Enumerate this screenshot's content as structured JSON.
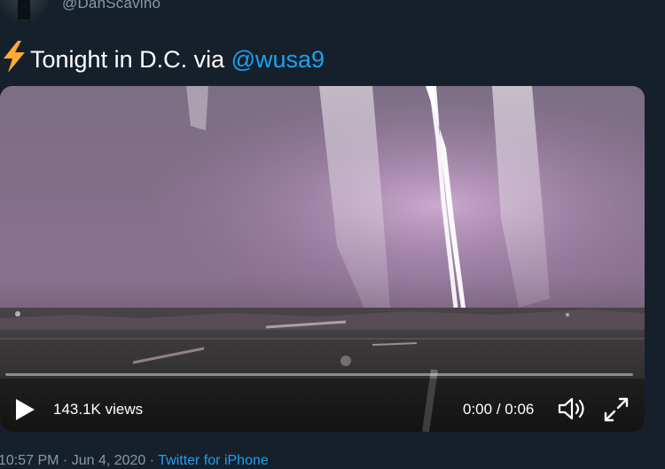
{
  "author": {
    "handle": "@DanScavino"
  },
  "tweet": {
    "text_before_mention": "Tonight in D.C. via ",
    "mention": "@wusa9",
    "emoji_icon": "lightning-bolt-icon"
  },
  "video": {
    "views": "143.1K views",
    "current_time": "0:00",
    "time_separator": " / ",
    "duration": "0:06",
    "progress_fraction": 0.0,
    "accent_color": "#1da1f2"
  },
  "footer": {
    "time": "10:57 PM",
    "separator1": " · ",
    "date": "Jun 4, 2020",
    "separator2": " · ",
    "source": "Twitter for iPhone"
  },
  "colors": {
    "background": "#15202b",
    "text_secondary": "#8899a6",
    "link": "#1da1f2"
  }
}
